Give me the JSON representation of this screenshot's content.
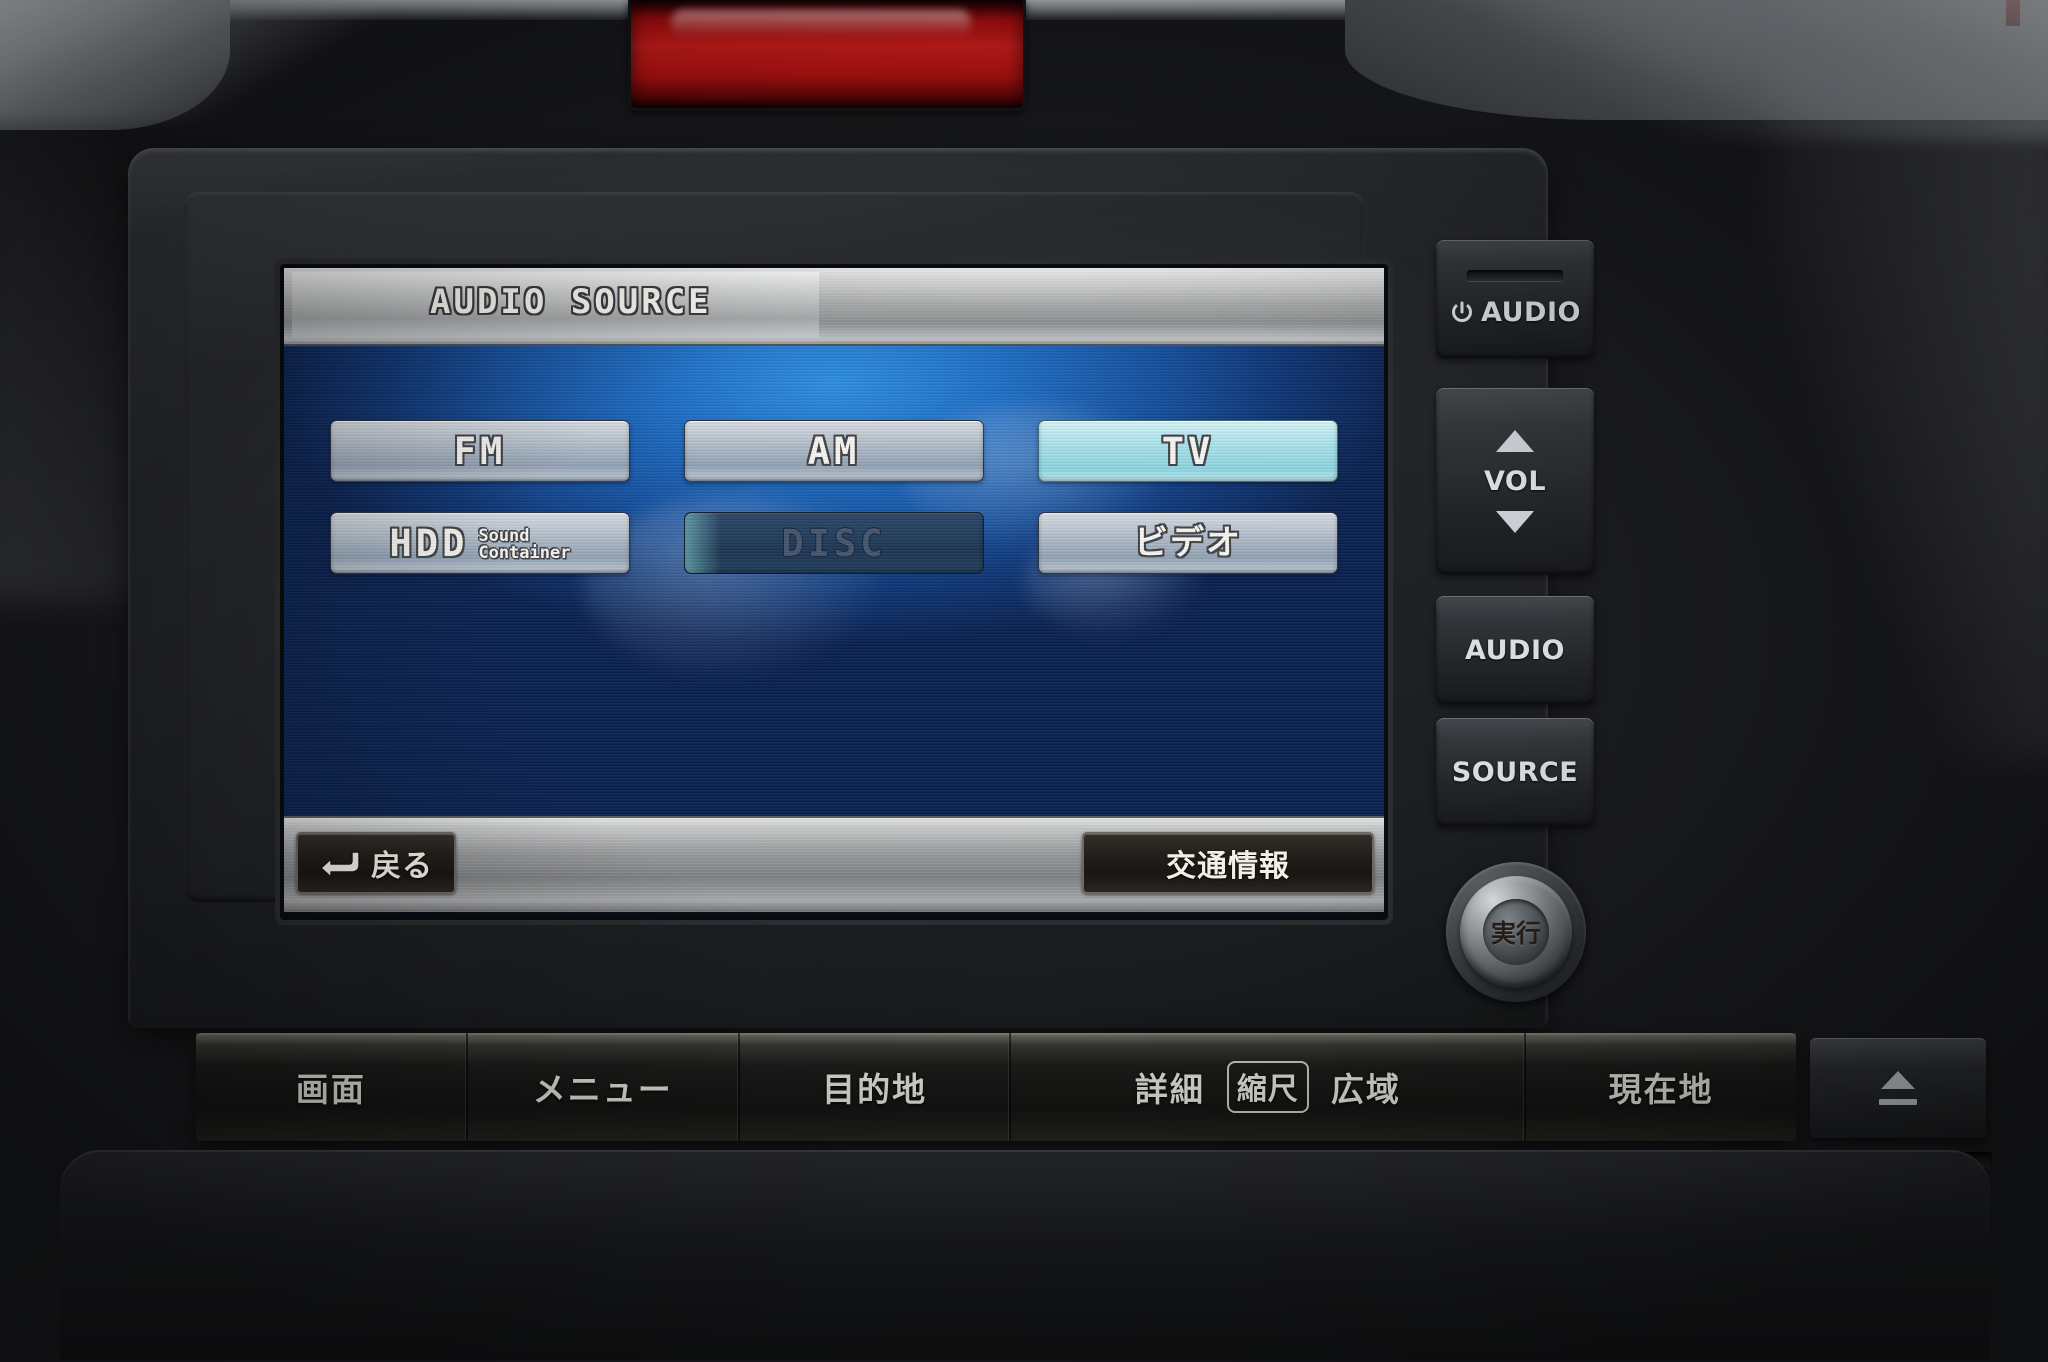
{
  "screen": {
    "title": "AUDIO SOURCE",
    "sources": [
      [
        {
          "label": "FM",
          "state": "normal",
          "icon": "fm-source-button"
        },
        {
          "label": "AM",
          "state": "normal",
          "icon": "am-source-button"
        },
        {
          "label": "TV",
          "state": "active",
          "icon": "tv-source-button"
        }
      ],
      [
        {
          "label": "HDD",
          "sub1": "Sound",
          "sub2": "Container",
          "state": "normal",
          "icon": "hdd-source-button"
        },
        {
          "label": "DISC",
          "state": "disabled",
          "icon": "disc-source-button"
        },
        {
          "label": "ビデオ",
          "state": "normal",
          "icon": "video-source-button"
        }
      ]
    ],
    "bottom_bar": {
      "back_label": "戻る",
      "back_icon": "return-arrow-icon",
      "traffic_label": "交通情報"
    },
    "colors": {
      "active_button": "#9fdde6",
      "normal_button": "#a8b4c2",
      "disabled_button": "#1e3653",
      "screen_blue": "#1f6ec4",
      "text": "#f7f5ef"
    }
  },
  "side_panel": {
    "power": {
      "label": "AUDIO",
      "icon": "power-icon"
    },
    "volume": {
      "label": "VOL",
      "up_icon": "triangle-up-icon",
      "down_icon": "triangle-down-icon"
    },
    "audio": {
      "label": "AUDIO"
    },
    "source": {
      "label": "SOURCE"
    },
    "knob": {
      "label": "実行",
      "icon": "rotary-knob"
    }
  },
  "lower_buttons": [
    {
      "label": "画面",
      "name": "screen-button"
    },
    {
      "label": "メニュー",
      "name": "menu-button"
    },
    {
      "label": "目的地",
      "name": "destination-button"
    },
    {
      "label": "詳細",
      "name": "detail-button",
      "boxed": "縮尺",
      "boxed_name": "scale-button",
      "label2": "広域",
      "label2_name": "wide-area-button"
    },
    {
      "label": "現在地",
      "name": "current-location-button"
    }
  ],
  "lower_buttons_flat": {
    "screen": "画面",
    "menu": "メニュー",
    "destination": "目的地",
    "detail": "詳細",
    "scale": "縮尺",
    "wide": "広域",
    "current": "現在地"
  },
  "eject": {
    "icon": "eject-icon"
  }
}
